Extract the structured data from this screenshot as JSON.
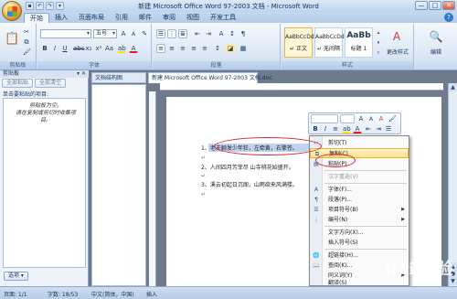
{
  "window": {
    "title": "新建 Microsoft Office Word 97-2003 文档 - Microsoft Word",
    "controls": [
      "—",
      "□",
      "✕"
    ]
  },
  "quick_access": [
    "save-icon",
    "undo-icon",
    "redo-icon",
    "dropdown-icon"
  ],
  "tabs": [
    "开始",
    "插入",
    "页面布局",
    "引用",
    "邮件",
    "审阅",
    "视图",
    "开发工具"
  ],
  "ribbon": {
    "groups": [
      "剪贴板",
      "字体",
      "段落",
      "样式"
    ],
    "font_size": "五号",
    "styles": [
      {
        "sample": "AaBbCcDd",
        "name": "↵ 正文"
      },
      {
        "sample": "AaBbCcDd",
        "name": "↵ 无间隔"
      },
      {
        "sample": "AaBb",
        "name": "标题 1"
      }
    ],
    "change_styles": "更改样式",
    "edit": "编辑"
  },
  "clipboard_pane": {
    "title": "剪贴板",
    "paste_all": "全部粘贴",
    "clear_all": "全部清空",
    "hint": "单击要粘贴的项目:",
    "empty_message": "剪贴板为空。\n请在复制或剪切时收集项目。",
    "options": "选项 ▾"
  },
  "doc_tabs": {
    "outline": "文档结构图",
    "document": "新建 Microsoft Office Word 97-2003 文档.doc"
  },
  "document": {
    "lines": [
      "1、老夫聊发少年狂，左牵黄，右擎苍。",
      "2、人间四月芳菲尽 山寺桃花始盛开。",
      "3、溪云初起日沉阁，山雨欲来风满楼。"
    ]
  },
  "mini_toolbar": {
    "row1": [
      "A",
      "A",
      "A",
      "A"
    ],
    "row2": [
      "B",
      "I",
      "≡",
      "A"
    ]
  },
  "context_menu": [
    {
      "label": "剪切(T)",
      "icon": "cut-icon",
      "submenu": false
    },
    {
      "label": "复制(C)",
      "icon": "copy-icon",
      "submenu": false
    },
    {
      "label": "粘贴(P)",
      "icon": "paste-icon",
      "submenu": false
    },
    {
      "label": "汉字重选(V)",
      "icon": "",
      "submenu": false
    },
    {
      "label": "字体(F)...",
      "icon": "font-icon",
      "submenu": false
    },
    {
      "label": "段落(P)...",
      "icon": "paragraph-icon",
      "submenu": false
    },
    {
      "label": "项目符号(B)",
      "icon": "bullets-icon",
      "submenu": true
    },
    {
      "label": "编号(N)",
      "icon": "numbering-icon",
      "submenu": true
    },
    {
      "label": "文字方向(X)...",
      "icon": "",
      "submenu": false
    },
    {
      "label": "插入符号(S)",
      "icon": "",
      "submenu": false
    },
    {
      "label": "超链接(H)...",
      "icon": "hyperlink-icon",
      "submenu": false
    },
    {
      "label": "查阅(K)...",
      "icon": "lookup-icon",
      "submenu": false
    },
    {
      "label": "同义词(Y)",
      "icon": "",
      "submenu": true
    },
    {
      "label": "翻译(S)",
      "icon": "",
      "submenu": false
    }
  ],
  "status": {
    "page": "页面: 1/1",
    "words": "字数: 18/53",
    "lang": "中文(简体，中国)",
    "mode": "插入"
  },
  "watermark": "Bai 经验"
}
